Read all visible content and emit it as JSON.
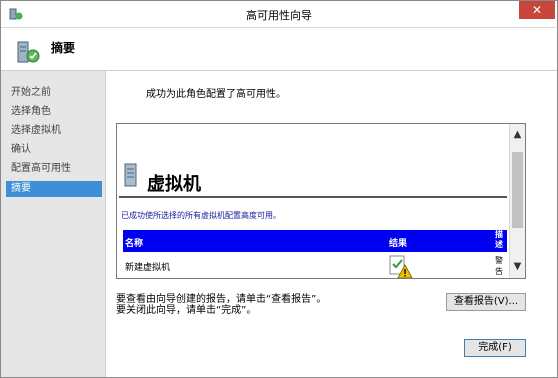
{
  "window": {
    "title": "高可用性向导",
    "close_glyph": "✕"
  },
  "header": {
    "title": "摘要",
    "icon": "cluster-wizard-icon"
  },
  "sidebar": {
    "items": [
      {
        "label": "开始之前",
        "active": false
      },
      {
        "label": "选择角色",
        "active": false
      },
      {
        "label": "选择虚拟机",
        "active": false
      },
      {
        "label": "确认",
        "active": false
      },
      {
        "label": "配置高可用性",
        "active": false
      },
      {
        "label": "摘要",
        "active": true
      }
    ]
  },
  "main": {
    "success_message": "成功为此角色配置了高可用性。",
    "report": {
      "heading": "虚拟机",
      "note": "已成功使所选择的所有虚拟机配置高度可用。",
      "table": {
        "columns": [
          "名称",
          "结果",
          "描述"
        ],
        "rows": [
          {
            "name": "新建虚拟机",
            "result_icon": "warning-check-icon",
            "description": "警告"
          }
        ]
      }
    },
    "instructions": [
      "要查看由向导创建的报告，请单击“查看报告”。",
      "要关闭此向导，请单击“完成”。"
    ],
    "view_report_label": "查看报告(V)...",
    "finish_label": "完成(F)"
  },
  "colors": {
    "accent": "#3d8fd6",
    "table_header": "#0000f0",
    "close_button": "#c8463b"
  }
}
